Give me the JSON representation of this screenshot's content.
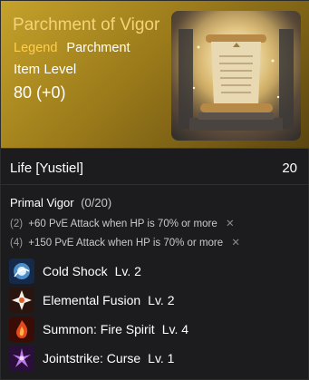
{
  "item": {
    "title": "Parchment of Vigor",
    "grade": "Legend",
    "type": "Parchment",
    "item_level_label": "Item Level",
    "item_level_value": "80 (+0)"
  },
  "life": {
    "label": "Life [Yustiel]",
    "value": "20"
  },
  "engraving": {
    "name": "Primal Vigor",
    "count": "(0/20)",
    "effects": [
      {
        "req": "(2)",
        "text": "+60 PvE Attack when HP is 70% or more",
        "mark": "✕"
      },
      {
        "req": "(4)",
        "text": "+150 PvE Attack when HP is 70% or more",
        "mark": "✕"
      }
    ]
  },
  "skills": [
    {
      "name": "Cold Shock",
      "level": "Lv. 2",
      "icon": "cold-shock-icon"
    },
    {
      "name": "Elemental Fusion",
      "level": "Lv. 2",
      "icon": "elemental-fusion-icon"
    },
    {
      "name": "Summon: Fire Spirit",
      "level": "Lv. 4",
      "icon": "fire-spirit-icon"
    },
    {
      "name": "Jointstrike: Curse",
      "level": "Lv. 1",
      "icon": "jointstrike-curse-icon"
    }
  ]
}
